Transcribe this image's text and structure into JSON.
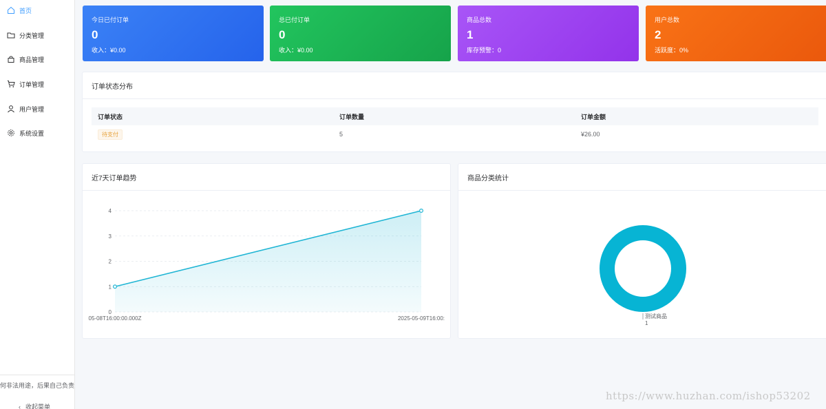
{
  "sidebar": {
    "items": [
      {
        "label": "首页",
        "icon": "home-icon",
        "active": true
      },
      {
        "label": "分类管理",
        "icon": "folder-icon"
      },
      {
        "label": "商品管理",
        "icon": "bag-icon"
      },
      {
        "label": "订单管理",
        "icon": "cart-icon"
      },
      {
        "label": "用户管理",
        "icon": "user-icon"
      },
      {
        "label": "系统设置",
        "icon": "gear-icon"
      }
    ],
    "disclaimer": "任何非法用途，后果自己负责",
    "collapse_label": "收起菜单"
  },
  "stats": [
    {
      "title": "今日已付订单",
      "value": "0",
      "sub": "收入：¥0.00",
      "color": "#2563eb"
    },
    {
      "title": "总已付订单",
      "value": "0",
      "sub": "收入：¥0.00",
      "color": "#16a34a"
    },
    {
      "title": "商品总数",
      "value": "1",
      "sub": "库存预警：0",
      "color": "#9333ea"
    },
    {
      "title": "用户总数",
      "value": "2",
      "sub": "活跃度：0%",
      "color": "#ea580c"
    }
  ],
  "order_status": {
    "title": "订单状态分布",
    "headers": [
      "订单状态",
      "订单数量",
      "订单金额"
    ],
    "rows": [
      {
        "status": "待支付",
        "count": "5",
        "amount": "¥26.00"
      }
    ]
  },
  "trend_panel": {
    "title": "近7天订单趋势"
  },
  "category_panel": {
    "title": "商品分类统计"
  },
  "chart_data": [
    {
      "type": "area",
      "x": [
        "2025-05-08T16:00:00.000Z",
        "2025-05-09T16:00:00.000Z"
      ],
      "values": [
        1,
        4
      ],
      "ylim": [
        0,
        4
      ],
      "yticks": [
        0,
        1,
        2,
        3,
        4
      ],
      "x_tick_labels": [
        "05-08T16:00:00.000Z",
        "2025-05-09T16:00:"
      ],
      "color": "#1fb5d4",
      "grid": true
    },
    {
      "type": "pie",
      "donut": true,
      "categories": [
        "测试商品"
      ],
      "values": [
        1
      ],
      "color": "#07b4d4"
    }
  ],
  "watermark": "https://www.huzhan.com/ishop53202"
}
